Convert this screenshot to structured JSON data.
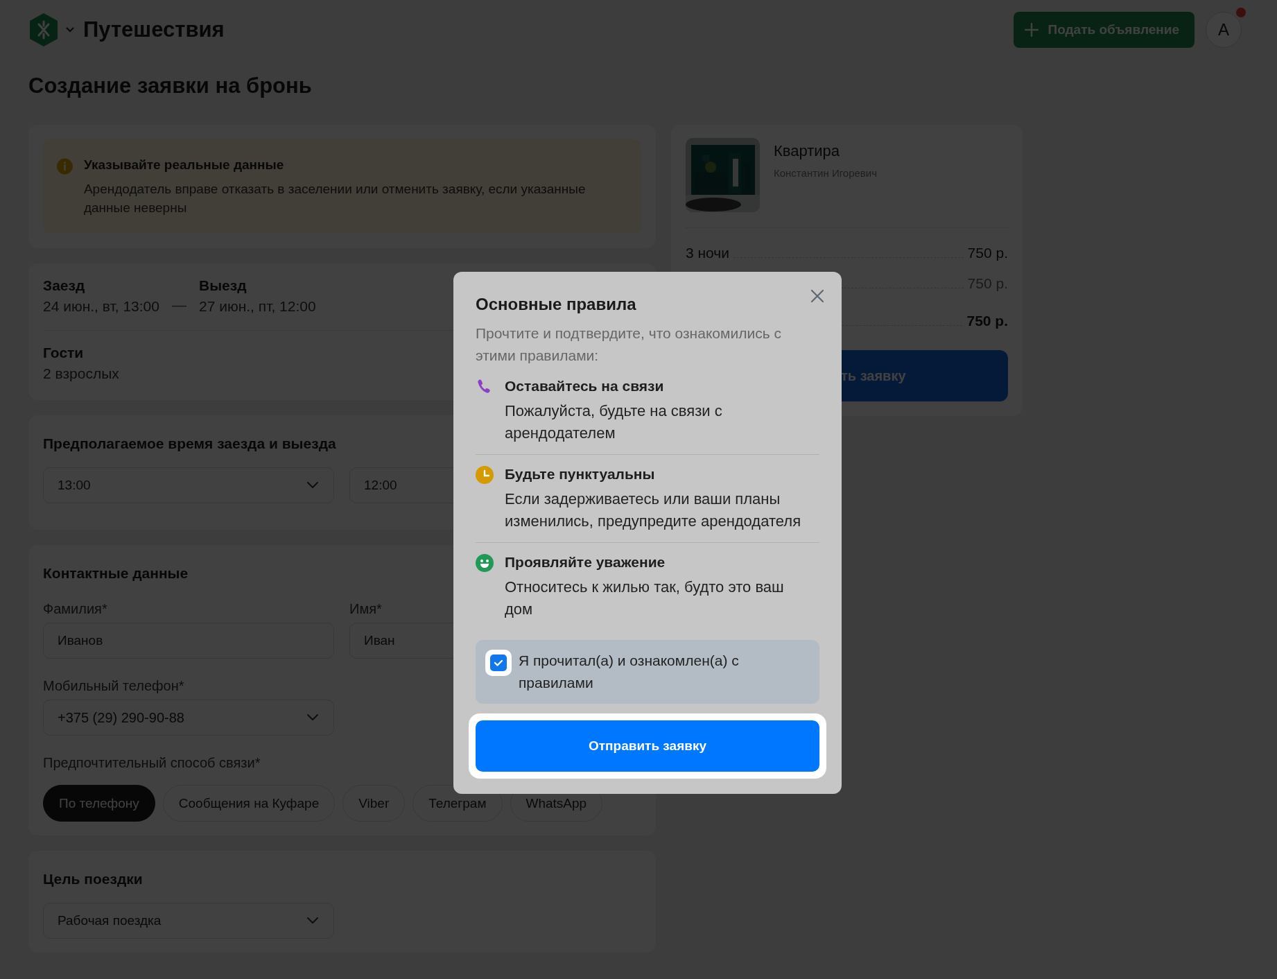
{
  "header": {
    "site_title": "Путешествия",
    "post_button": "Подать объявление",
    "avatar": {
      "initial": "А",
      "notification": true
    }
  },
  "page_title": "Создание заявки на бронь",
  "notice": {
    "title": "Указывайте реальные данные",
    "text": "Арендодатель вправе отказать в заселении или отменить заявку, если указанные данные неверны"
  },
  "booking": {
    "checkin": {
      "label": "Заезд",
      "value": "24 июн., вт, 13:00"
    },
    "separator": "—",
    "checkout": {
      "label": "Выезд",
      "value": "27 июн., пт, 12:00"
    },
    "guests": {
      "label": "Гости",
      "value": "2 взрослых"
    }
  },
  "arrival_time": {
    "title": "Предполагаемое время заезда и выезда",
    "selects": [
      "13:00",
      "12:00"
    ]
  },
  "contacts": {
    "title": "Контактные данные",
    "fields": [
      {
        "label": "Фамилия*",
        "value": "Иванов"
      },
      {
        "label": "Имя*",
        "value": "Иван"
      }
    ],
    "phone": {
      "label": "Мобильный телефон*",
      "value": "+375 (29) 290-90-88"
    },
    "method": {
      "label": "Предпочтительный способ связи*",
      "options": [
        {
          "label": "По телефону",
          "selected": true
        },
        {
          "label": "Сообщения на Куфаре",
          "selected": false
        },
        {
          "label": "Viber",
          "selected": false
        },
        {
          "label": "Телеграм",
          "selected": false
        },
        {
          "label": "WhatsApp",
          "selected": false
        }
      ]
    }
  },
  "trip_purpose": {
    "title": "Цель поездки",
    "value": "Рабочая поездка"
  },
  "summary": {
    "listing": {
      "kind": "picture",
      "title": "Квартира",
      "host": "Константин Игоревич"
    },
    "rows": [
      {
        "kind": "regular",
        "label": "3 ночи",
        "value": "750 р."
      },
      {
        "kind": "muted",
        "value": "750 р."
      },
      {
        "kind": "total",
        "value": "750 р."
      }
    ],
    "button": "ть заявку"
  },
  "modal": {
    "title": "Основные правила",
    "subtitle": "Прочтите и подтвердите, что ознакомились с этими правилами:",
    "rules": [
      {
        "kind": "phone",
        "color": "#8a3fc4",
        "title": "Оставайтесь на связи",
        "text": "Пожалуйста, будьте на связи с арендодателем"
      },
      {
        "kind": "clock",
        "color": "#d49a00",
        "title": "Будьте пунктуальны",
        "text": "Если задерживаетесь или ваши планы изменились, предупредите арендодателя"
      },
      {
        "kind": "smile",
        "color": "#1f9a55",
        "title": "Проявляйте уважение",
        "text": "Относитесь к жилью так, будто это ваш дом"
      }
    ],
    "agreement": {
      "label": "Я прочитал(а) и ознакомлен(а) с правилами",
      "checked": true
    },
    "submit": "Отправить заявку"
  }
}
